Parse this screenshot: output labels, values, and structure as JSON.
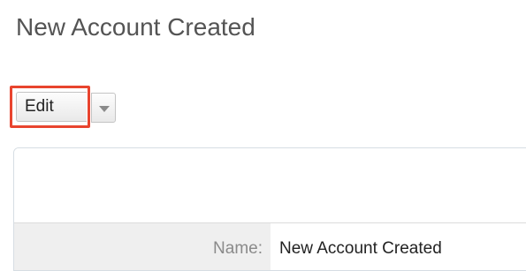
{
  "page": {
    "title": "New Account Created"
  },
  "toolbar": {
    "edit_label": "Edit",
    "dropdown_icon": "caret-down-icon",
    "highlight_color": "#e8442e"
  },
  "record": {
    "fields": [
      {
        "label": "Name:",
        "value": "New Account Created"
      }
    ]
  }
}
